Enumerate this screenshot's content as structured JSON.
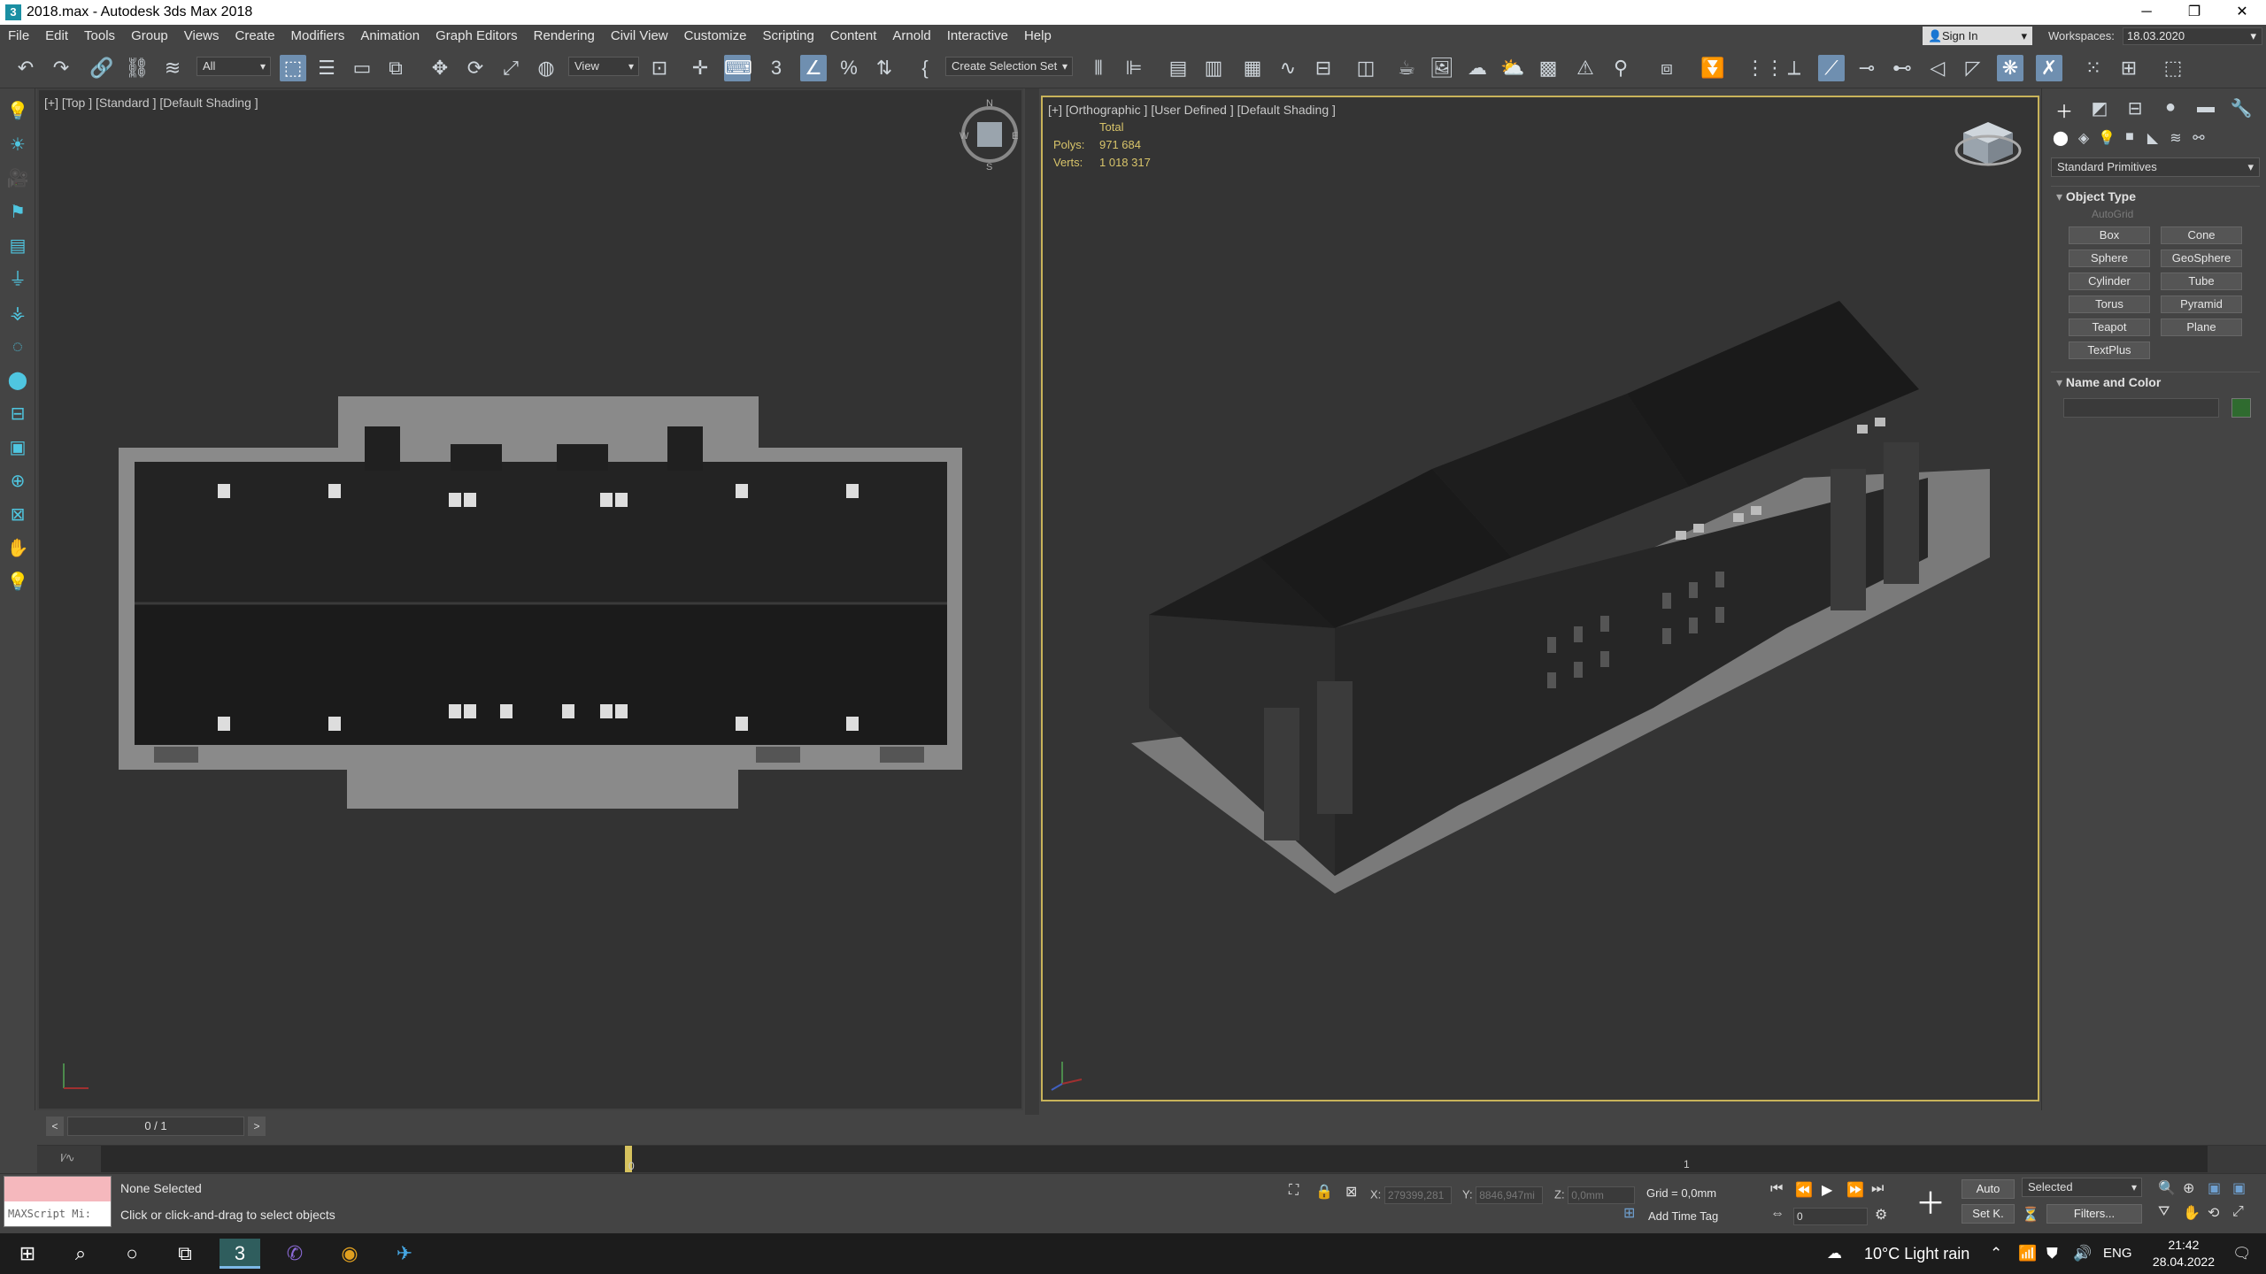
{
  "window": {
    "title": "2018.max - Autodesk 3ds Max 2018",
    "app_icon": "3",
    "minimize": "─",
    "maximize": "❐",
    "close": "✕"
  },
  "menu": [
    "File",
    "Edit",
    "Tools",
    "Group",
    "Views",
    "Create",
    "Modifiers",
    "Animation",
    "Graph Editors",
    "Rendering",
    "Civil View",
    "Customize",
    "Scripting",
    "Content",
    "Arnold",
    "Interactive",
    "Help"
  ],
  "account": {
    "signin": "Sign In",
    "workspaces_label": "Workspaces:",
    "workspace_value": "18.03.2020"
  },
  "toolbar": {
    "filter": "All",
    "ref_coord": "View",
    "selection_set": "Create Selection Set"
  },
  "viewport_top": {
    "label": "[+] [Top ] [Standard ] [Default Shading ]"
  },
  "viewport_persp": {
    "label": "[+] [Orthographic ] [User Defined ] [Default Shading ]",
    "stats_total": "Total",
    "polys_label": "Polys:",
    "polys_value": "971 684",
    "verts_label": "Verts:",
    "verts_value": "1 018 317"
  },
  "command_panel": {
    "category": "Standard Primitives",
    "object_type_header": "Object Type",
    "autogrid": "AutoGrid",
    "primitives": [
      "Box",
      "Cone",
      "Sphere",
      "GeoSphere",
      "Cylinder",
      "Tube",
      "Torus",
      "Pyramid",
      "Teapot",
      "Plane",
      "TextPlus"
    ],
    "name_color_header": "Name and Color",
    "color": "#2f6b2f"
  },
  "time": {
    "frame_display": "0 / 1",
    "prev": "<",
    "next": ">",
    "tick_0": "0",
    "tick_1": "1"
  },
  "status": {
    "selection": "None Selected",
    "prompt": "Click or click-and-drag to select objects",
    "maxscript": "MAXScript Mi:",
    "x_label": "X:",
    "x_value": "279399,281",
    "y_label": "Y:",
    "y_value": "8846,947mi",
    "z_label": "Z:",
    "z_value": "0,0mm",
    "grid": "Grid = 0,0mm",
    "add_time_tag": "Add Time Tag",
    "auto": "Auto",
    "set_key": "Set K.",
    "selected_dropdown": "Selected",
    "filters": "Filters...",
    "frame_field": "0"
  },
  "taskbar": {
    "weather": "10°C  Light rain",
    "lang": "ENG",
    "time": "21:42",
    "date": "28.04.2022"
  }
}
